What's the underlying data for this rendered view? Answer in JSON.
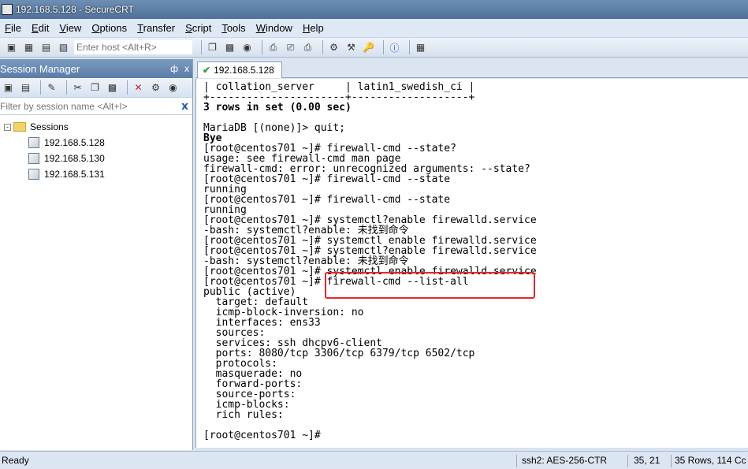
{
  "window": {
    "title": "192.168.5.128 - SecureCRT"
  },
  "menu": [
    "File",
    "Edit",
    "View",
    "Options",
    "Transfer",
    "Script",
    "Tools",
    "Window",
    "Help"
  ],
  "toolbar": {
    "host_placeholder": "Enter host <Alt+R>"
  },
  "session_manager": {
    "title": "Session Manager",
    "pin": "ф",
    "close": "x",
    "filter_placeholder": "Filter by session name <Alt+I>",
    "filter_clear": "x",
    "tree": {
      "root_label": "Sessions",
      "expander": "-",
      "items": [
        "192.168.5.128",
        "192.168.5.130",
        "192.168.5.131"
      ]
    }
  },
  "tabs": [
    {
      "label": "192.168.5.128",
      "status_icon": "✔"
    }
  ],
  "terminal": {
    "lines": [
      {
        "text": "| collation_server     | latin1_swedish_ci |",
        "bold": false
      },
      {
        "text": "+----------------------+-------------------+",
        "bold": false
      },
      {
        "text": "3 rows in set (0.00 sec)",
        "bold": true
      },
      {
        "text": "",
        "bold": false
      },
      {
        "text": "MariaDB [(none)]> quit;",
        "bold": false
      },
      {
        "text": "Bye",
        "bold": true
      },
      {
        "text": "[root@centos701 ~]# firewall-cmd --state?",
        "bold": false
      },
      {
        "text": "usage: see firewall-cmd man page",
        "bold": false
      },
      {
        "text": "firewall-cmd: error: unrecognized arguments: --state?",
        "bold": false
      },
      {
        "text": "[root@centos701 ~]# firewall-cmd --state",
        "bold": false
      },
      {
        "text": "running",
        "bold": false
      },
      {
        "text": "[root@centos701 ~]# firewall-cmd --state",
        "bold": false
      },
      {
        "text": "running",
        "bold": false
      },
      {
        "text": "[root@centos701 ~]# systemctl?enable firewalld.service",
        "bold": false
      },
      {
        "text": "-bash: systemctl?enable: 未找到命令",
        "bold": false
      },
      {
        "text": "[root@centos701 ~]# systemctl enable firewalld.service",
        "bold": false
      },
      {
        "text": "[root@centos701 ~]# systemctl?enable firewalld.service",
        "bold": false
      },
      {
        "text": "-bash: systemctl?enable: 未找到命令",
        "bold": false
      },
      {
        "text": "[root@centos701 ~]# systemctl enable firewalld.service",
        "bold": false
      },
      {
        "text": "[root@centos701 ~]# firewall-cmd --list-all",
        "bold": false
      },
      {
        "text": "public (active)",
        "bold": false
      },
      {
        "text": "  target: default",
        "bold": false
      },
      {
        "text": "  icmp-block-inversion: no",
        "bold": false
      },
      {
        "text": "  interfaces: ens33",
        "bold": false
      },
      {
        "text": "  sources:",
        "bold": false
      },
      {
        "text": "  services: ssh dhcpv6-client",
        "bold": false
      },
      {
        "text": "  ports: 8080/tcp 3306/tcp 6379/tcp 6502/tcp",
        "bold": false
      },
      {
        "text": "  protocols:",
        "bold": false
      },
      {
        "text": "  masquerade: no",
        "bold": false
      },
      {
        "text": "  forward-ports:",
        "bold": false
      },
      {
        "text": "  source-ports:",
        "bold": false
      },
      {
        "text": "  icmp-blocks:",
        "bold": false
      },
      {
        "text": "  rich rules:",
        "bold": false
      },
      {
        "text": "",
        "bold": false
      },
      {
        "text": "[root@centos701 ~]#",
        "bold": false
      }
    ],
    "highlight_color": "#e8262b"
  },
  "status": {
    "state": "Ready",
    "protocol": "ssh2: AES-256-CTR",
    "cursor": "35,  21",
    "size": "35 Rows, 114 Cc"
  }
}
